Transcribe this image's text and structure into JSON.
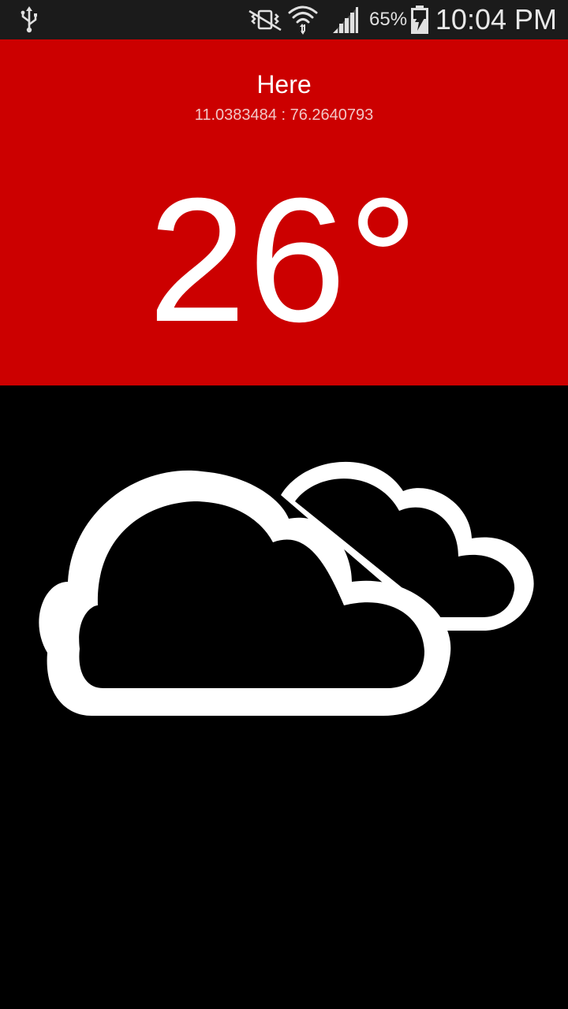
{
  "status_bar": {
    "battery_percent": "65%",
    "time": "10:04 PM",
    "icons": [
      "usb-icon",
      "mute-vibrate-icon",
      "wifi-icon",
      "signal-icon",
      "battery-charging-icon"
    ]
  },
  "weather": {
    "location": "Here",
    "coordinates": "11.0383484 : 76.2640793",
    "temperature": "26°",
    "condition_icon": "cloudy-icon"
  },
  "colors": {
    "header_background": "#cc0000",
    "body_background": "#000000",
    "text": "#ffffff"
  }
}
